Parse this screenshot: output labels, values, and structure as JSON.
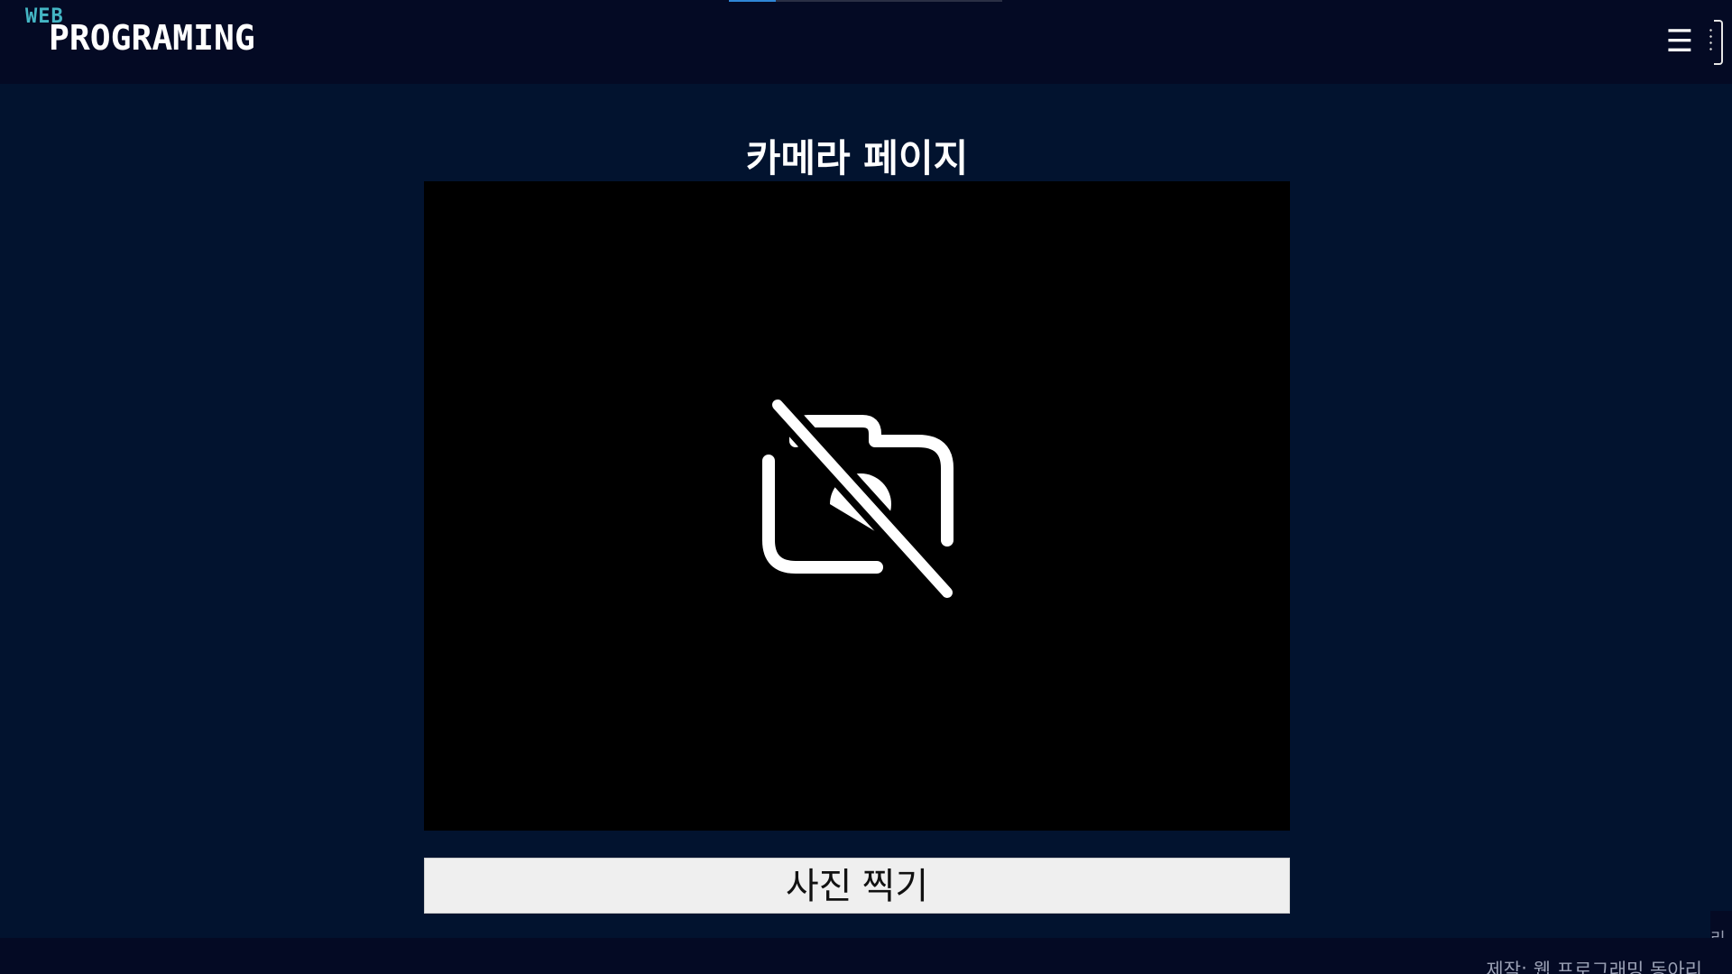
{
  "header": {
    "logo_small": "WEB",
    "logo_main": "PROGRAMING",
    "menu_icon": "☰",
    "top_progress_fraction": 0.17
  },
  "main": {
    "title": "카메라 페이지",
    "camera": {
      "icon": "camera-off-icon"
    },
    "shoot_button_label": "사진 찍기"
  },
  "footer": {
    "credit": "제작: 웹 프로그래밍 동아리",
    "side_fragment": "리"
  },
  "colors": {
    "header_bg": "#040a24",
    "page_bg": "#02132f",
    "logo_accent": "#44b6c4",
    "camera_bg": "#000000",
    "button_bg": "#efefef"
  }
}
